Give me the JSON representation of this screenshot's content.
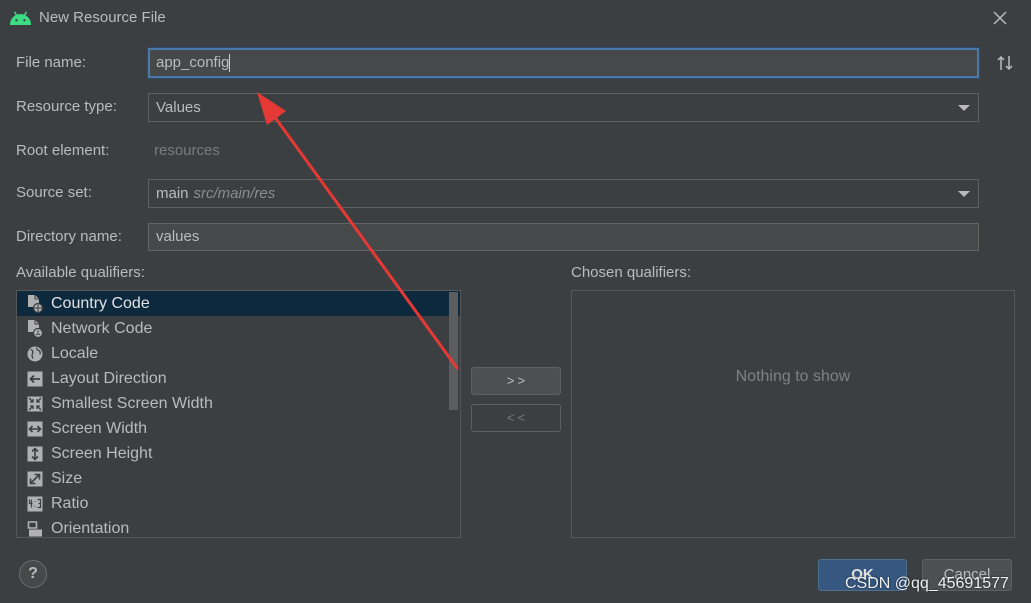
{
  "window": {
    "title": "New Resource File"
  },
  "form": {
    "file_name": {
      "label": "File name:",
      "value": "app_config"
    },
    "resource_type": {
      "label": "Resource type:",
      "value": "Values"
    },
    "root_element": {
      "label": "Root element:",
      "value": "resources"
    },
    "source_set": {
      "label": "Source set:",
      "value": "main",
      "path_hint": "src/main/res"
    },
    "directory_name": {
      "label": "Directory name:",
      "value": "values"
    }
  },
  "available_qualifiers": {
    "label": "Available qualifiers:",
    "items": [
      {
        "label": "Country Code",
        "icon": "country-code-icon",
        "selected": true
      },
      {
        "label": "Network Code",
        "icon": "network-code-icon"
      },
      {
        "label": "Locale",
        "icon": "locale-icon"
      },
      {
        "label": "Layout Direction",
        "icon": "layout-direction-icon"
      },
      {
        "label": "Smallest Screen Width",
        "icon": "smallest-screen-width-icon"
      },
      {
        "label": "Screen Width",
        "icon": "screen-width-icon"
      },
      {
        "label": "Screen Height",
        "icon": "screen-height-icon"
      },
      {
        "label": "Size",
        "icon": "size-icon"
      },
      {
        "label": "Ratio",
        "icon": "ratio-icon"
      },
      {
        "label": "Orientation",
        "icon": "orientation-icon"
      }
    ]
  },
  "transfer_buttons": {
    "add_label": ">>",
    "remove_label": "<<",
    "remove_enabled": false
  },
  "chosen_qualifiers": {
    "label": "Chosen qualifiers:",
    "empty_text": "Nothing to show"
  },
  "footer": {
    "help_label": "?",
    "ok_label": "OK",
    "cancel_label": "Cancel"
  },
  "watermark": {
    "text": "CSDN @qq_45691577"
  },
  "icons": {
    "window": "android-icon",
    "close": "close-icon",
    "sort": "sort-icon",
    "dropdown": "chevron-down-icon",
    "help": "help-icon"
  },
  "colors": {
    "background": "#3c3f41",
    "text": "#bbbbbb",
    "accent": "#365880",
    "selection": "#0d293e",
    "annotation_arrow": "#e53935",
    "window_icon": "#3ddc84"
  }
}
